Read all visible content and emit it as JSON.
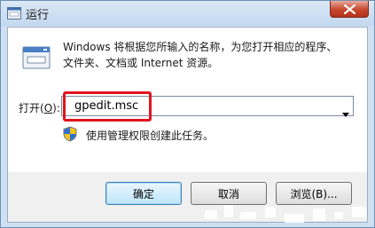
{
  "window": {
    "title": "运行"
  },
  "description": {
    "line1": "Windows 将根据您所输入的名称，为您打开相应的程序、",
    "line2": "文件夹、文档或 Internet 资源。"
  },
  "open_field": {
    "label_prefix": "打开(",
    "label_accel": "O",
    "label_suffix": "):",
    "value": "gpedit.msc"
  },
  "admin_note": "使用管理权限创建此任务。",
  "buttons": {
    "ok": "确定",
    "cancel": "取消",
    "browse": "浏览(B)..."
  },
  "colors": {
    "highlight": "#e0141e",
    "close_button": "#c7472e",
    "default_button_border": "#3c7fb1"
  }
}
